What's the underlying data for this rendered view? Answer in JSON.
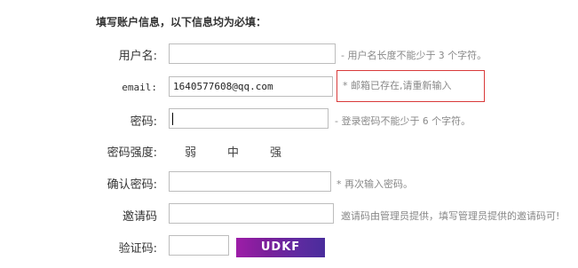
{
  "form": {
    "heading": "填写账户信息，以下信息均为必填：",
    "username": {
      "label": "用户名:",
      "value": "",
      "hint_prefix": "- 用户名长度不能少于",
      "hint_num": "3",
      "hint_suffix": "个字符。"
    },
    "email": {
      "label": "email:",
      "value": "1640577608@qq.com",
      "error": "* 邮箱已存在,请重新输入"
    },
    "password": {
      "label": "密码:",
      "value": "",
      "hint_prefix": "- 登录密码不能少于",
      "hint_num": "6",
      "hint_suffix": "个字符。"
    },
    "strength": {
      "label": "密码强度:",
      "levels": [
        "弱",
        "中",
        "强"
      ]
    },
    "confirm": {
      "label": "确认密码:",
      "value": "",
      "hint": "* 再次输入密码。"
    },
    "invite": {
      "label": "邀请码",
      "value": "",
      "hint": "邀请码由管理员提供，填写管理员提供的邀请码可!"
    },
    "captcha": {
      "label": "验证码:",
      "value": "",
      "image_text": "UDKF"
    }
  }
}
